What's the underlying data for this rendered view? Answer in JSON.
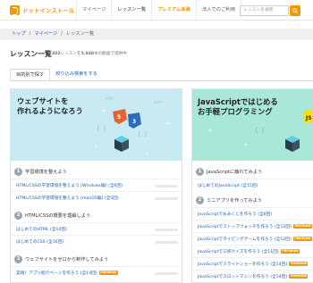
{
  "header": {
    "logo_text": "ドットインストール",
    "nav": [
      "マイページ",
      "レッスン一覧",
      "プレミアム会員",
      "法人でのご利用"
    ],
    "search_placeholder": "レッスンを検索"
  },
  "breadcrumb": [
    "トップ",
    "マイページ",
    "レッスン一覧"
  ],
  "page": {
    "title": "レッスン一覧",
    "summary_count": "402",
    "summary_mid": "レッスンを",
    "summary_videos": "5,948",
    "summary_tail": "本の動画で提供中"
  },
  "tabs": [
    "目的別で探す",
    "絞り込み検索をする"
  ],
  "cards": [
    {
      "hero_line1": "ウェブサイトを",
      "hero_line2": "作れるようになろう",
      "sections": [
        {
          "num": "1",
          "title": "学習環境を整えよう",
          "lessons": [
            {
              "text": "HTML/CSSの学習環境を整えよう [Windows編]",
              "dur": "(全6回)",
              "premium": false
            },
            {
              "text": "HTML/CSSの学習環境を整えよう [macOS編]",
              "dur": "(全5回)",
              "premium": false
            }
          ]
        },
        {
          "num": "2",
          "title": "HTML/CSSの概要を理解しよう",
          "lessons": [
            {
              "text": "はじめてのHTML",
              "dur": "(全14回)",
              "premium": false
            },
            {
              "text": "はじめてのCSS",
              "dur": "(全16回)",
              "premium": false
            }
          ]
        },
        {
          "num": "3",
          "title": "ウェブサイトをゼロから制作してみよう",
          "lessons": [
            {
              "text": "実践！アプリ紹介ページを作ろう",
              "dur": "(全14回)",
              "premium": true
            }
          ]
        }
      ]
    },
    {
      "hero_line1": "JavaScriptではじめる",
      "hero_line2": "お手軽プログラミング",
      "sections": [
        {
          "num": "1",
          "title": "JavaScriptに触れてみよう",
          "lessons": [
            {
              "text": "はじめてのJavaScript",
              "dur": "(全15回)",
              "premium": false
            }
          ]
        },
        {
          "num": "2",
          "title": "ミニアプリを作ってみよう",
          "lessons": [
            {
              "text": "JavaScriptでおみくじを作ろう",
              "dur": "(全8回)",
              "premium": false
            },
            {
              "text": "JavaScriptでストップウォッチを作ろう",
              "dur": "(全12回)",
              "premium": true
            },
            {
              "text": "JavaScriptでタイピングゲームを作ろう",
              "dur": "(全12回)",
              "premium": true
            },
            {
              "text": "JavaScriptで三択クイズを作ろう",
              "dur": "(全11回)",
              "premium": true
            },
            {
              "text": "JavaScriptでスライドショーを作ろう",
              "dur": "(全14回)",
              "premium": true
            },
            {
              "text": "JavaScriptでスロットマシンを作ろう",
              "dur": "(全14回)",
              "premium": true
            }
          ]
        }
      ]
    }
  ],
  "badge_label": "PREMIUM",
  "colors": {
    "accent": "#f39800",
    "link": "#1a5fb4",
    "hero1": "#c8ebf3",
    "hero2": "#a9e7d9"
  }
}
